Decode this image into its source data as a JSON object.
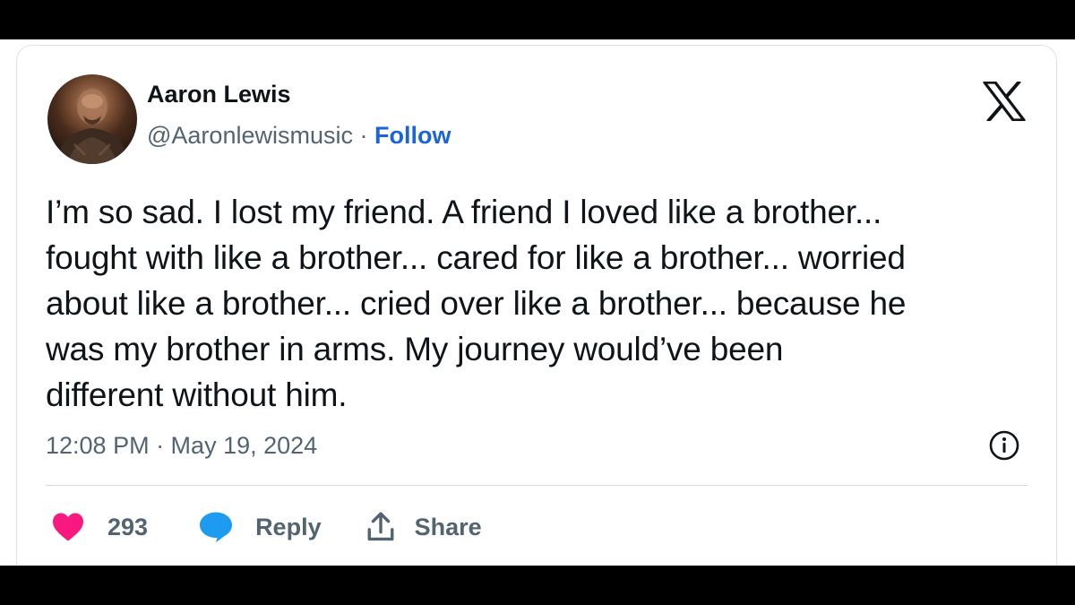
{
  "tweet": {
    "author": {
      "display_name": "Aaron Lewis",
      "handle": "@Aaronlewismusic",
      "separator": " · ",
      "follow_label": "Follow"
    },
    "text_lines": [
      "I’m so sad. I lost my friend. A friend I loved like a brother...",
      "fought with like a brother... cared for like a brother... worried",
      "about like a brother... cried over like a brother... because he",
      "was my brother in arms. My journey would’ve been",
      "different without him."
    ],
    "timestamp": "12:08 PM · May 19, 2024",
    "actions": {
      "like_count": "293",
      "reply_label": "Reply",
      "share_label": "Share"
    },
    "icons": {
      "platform": "x-logo-icon",
      "info": "info-icon",
      "like": "heart-icon",
      "reply": "speech-bubble-icon",
      "share": "share-arrow-icon"
    },
    "colors": {
      "text": "#0f1419",
      "secondary": "#536471",
      "link": "#1d64d8",
      "like": "#f91880",
      "reply": "#1d9bf0",
      "border": "#dfe3e8"
    }
  }
}
